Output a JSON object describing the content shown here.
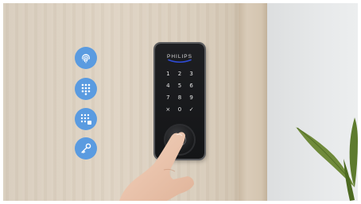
{
  "scene": {
    "description_colors": {
      "icon_blue": "#5a9be0",
      "lock_body": "#1a1b1e",
      "keypad_text": "#e6e6e6",
      "brand_arc": "#2f4bd6"
    }
  },
  "feature_icons": [
    {
      "name": "fingerprint-icon"
    },
    {
      "name": "keypad-icon"
    },
    {
      "name": "keypad-passcode-icon"
    },
    {
      "name": "key-icon"
    }
  ],
  "lock": {
    "brand": "PHILIPS",
    "keypad": [
      "1",
      "2",
      "3",
      "4",
      "5",
      "6",
      "7",
      "8",
      "9",
      "×",
      "0",
      "✓"
    ]
  }
}
